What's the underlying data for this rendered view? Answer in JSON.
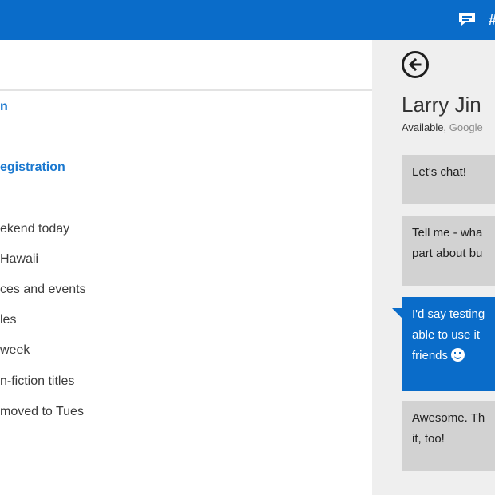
{
  "app": {
    "colors": {
      "accent": "#0a6cc9",
      "link": "#1a78cf"
    },
    "icons": {
      "chat": "chat-bubble-icon",
      "more": "more-icon",
      "back": "back-arrow-icon",
      "emoji": "smiley-icon"
    }
  },
  "left_list": {
    "items": [
      {
        "text": "n",
        "style": "link"
      },
      {
        "text": "egistration",
        "style": "link"
      },
      {
        "text": "ekend today",
        "style": "normal"
      },
      {
        "text": "Hawaii",
        "style": "normal"
      },
      {
        "text": "ces and events",
        "style": "normal"
      },
      {
        "text": "les",
        "style": "normal"
      },
      {
        "text": "week",
        "style": "normal"
      },
      {
        "text": "n-fiction titles",
        "style": "normal"
      },
      {
        "text": "moved to Tues",
        "style": "normal"
      }
    ]
  },
  "chat": {
    "contact_name": "Larry Jin",
    "status": "Available",
    "status_separator": ", ",
    "service": "Google",
    "messages": [
      {
        "direction": "in",
        "lines": [
          "Let's chat!"
        ]
      },
      {
        "direction": "in",
        "lines": [
          "Tell me - wha",
          "part about bu"
        ]
      },
      {
        "direction": "out",
        "lines": [
          "I'd say testing",
          "able to use it",
          "friends"
        ],
        "emoji": true
      },
      {
        "direction": "in",
        "lines": [
          "Awesome. Th",
          "it, too!"
        ]
      }
    ]
  }
}
